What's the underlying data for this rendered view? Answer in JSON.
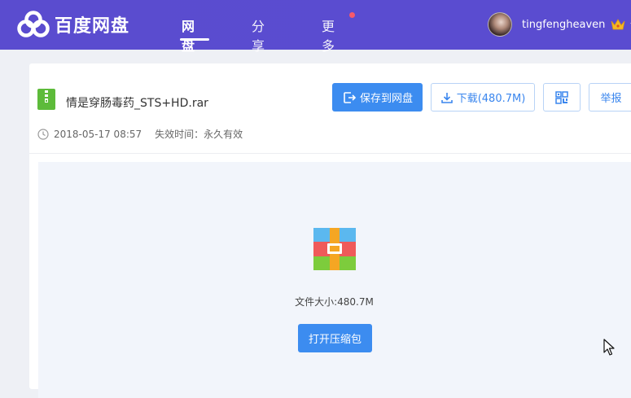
{
  "header": {
    "logo_text": "百度网盘",
    "nav": [
      {
        "label": "网盘",
        "active": true
      },
      {
        "label": "分享",
        "active": false
      },
      {
        "label": "更多",
        "active": false,
        "has_dot": true
      }
    ],
    "username": "tingfengheaven"
  },
  "file": {
    "name": "情是穿肠毒药_STS+HD.rar",
    "date": "2018-05-17 08:57",
    "expire": "失效时间：永久有效"
  },
  "actions": {
    "save_label": "保存到网盘",
    "download_label": "下载(480.7M)",
    "report_label": "举报"
  },
  "preview": {
    "size_text": "文件大小:480.7M",
    "open_label": "打开压缩包"
  },
  "colors": {
    "header_bg": "#5a4ccf",
    "primary": "#3c8cf0",
    "nav_dot": "#f7596a"
  }
}
